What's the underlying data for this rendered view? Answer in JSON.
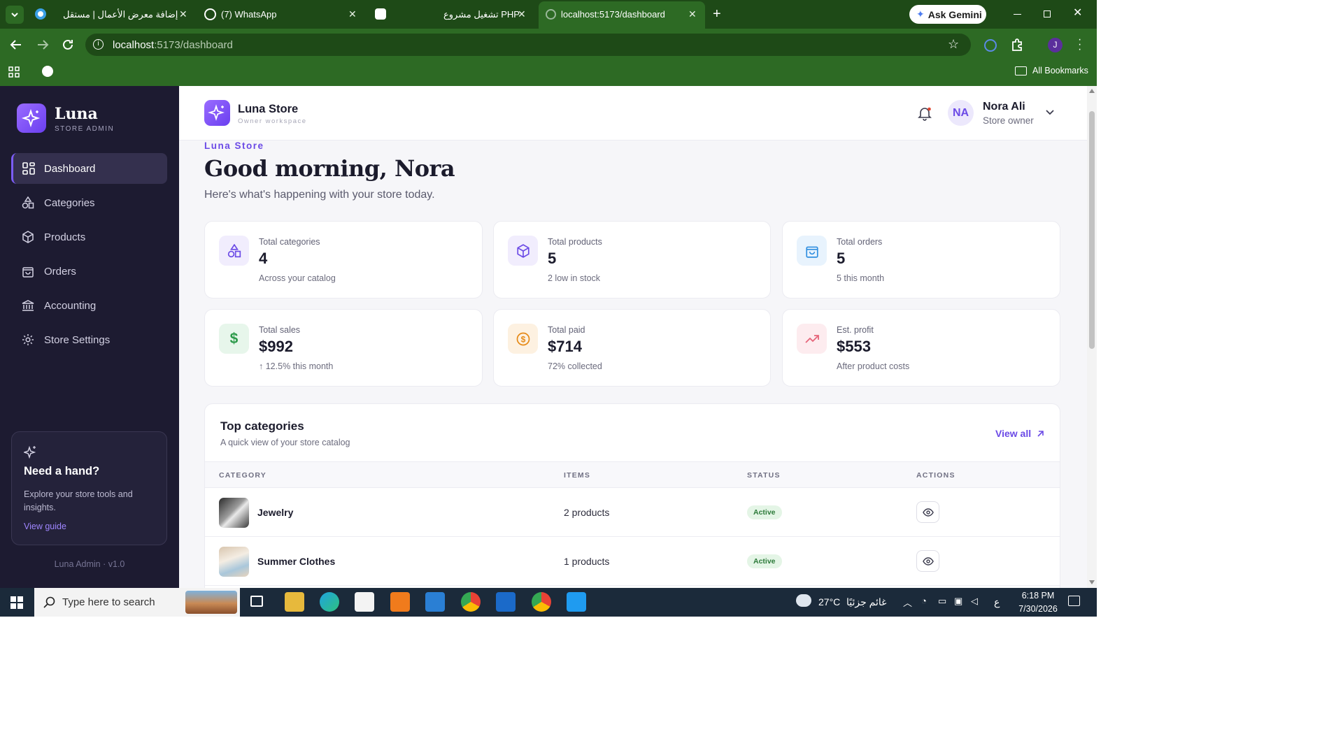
{
  "browser": {
    "tabs": [
      {
        "title": "إضافة معرض الأعمال | مستقل",
        "close": "✕"
      },
      {
        "title": "(7) WhatsApp",
        "close": "✕"
      },
      {
        "title": "تشغيل مشروع PHP",
        "close": "✕"
      },
      {
        "title": "localhost:5173/dashboard",
        "close": "✕"
      }
    ],
    "new_tab": "+",
    "ask_gemini": "Ask Gemini",
    "url_host": "localhost",
    "url_rest": ":5173/dashboard",
    "profile_initial": "J",
    "all_bookmarks": "All Bookmarks"
  },
  "sidebar": {
    "brand": "Luna",
    "brand_sub": "STORE ADMIN",
    "items": [
      {
        "label": "Dashboard",
        "icon": "grid-icon"
      },
      {
        "label": "Categories",
        "icon": "shapes-icon"
      },
      {
        "label": "Products",
        "icon": "box-icon"
      },
      {
        "label": "Orders",
        "icon": "bag-icon"
      },
      {
        "label": "Accounting",
        "icon": "bank-icon"
      },
      {
        "label": "Store Settings",
        "icon": "gear-icon"
      }
    ],
    "help": {
      "title": "Need a hand?",
      "text": "Explore your store tools and insights.",
      "link": "View guide"
    },
    "version": "Luna Admin · v1.0"
  },
  "header": {
    "store": "Luna Store",
    "store_sub": "Owner workspace",
    "avatar": "NA",
    "user": "Nora Ali",
    "role": "Store owner"
  },
  "hero": {
    "eyebrow": "Luna Store",
    "greeting": "Good morning, Nora",
    "sub": "Here's what's happening with your store today."
  },
  "stats": [
    {
      "label": "Total categories",
      "value": "4",
      "sub": "Across your catalog",
      "icon": "shapes-icon"
    },
    {
      "label": "Total products",
      "value": "5",
      "sub": "2 low in stock",
      "icon": "box-icon"
    },
    {
      "label": "Total orders",
      "value": "5",
      "sub": "5 this month",
      "icon": "bag-icon"
    },
    {
      "label": "Total sales",
      "value": "$992",
      "sub": "12.5% this month",
      "icon": "dollar-icon"
    },
    {
      "label": "Total paid",
      "value": "$714",
      "sub": "72% collected",
      "icon": "coin-icon"
    },
    {
      "label": "Est. profit",
      "value": "$553",
      "sub": "After product costs",
      "icon": "trend-up-icon"
    }
  ],
  "colors": {
    "accent": "#7b5cf5",
    "sidebar": "#1d1b31",
    "active_badge": "#2c7a39"
  },
  "top_categories": {
    "title": "Top categories",
    "sub": "A quick view of your store catalog",
    "view_all": "View all",
    "columns": [
      "CATEGORY",
      "ITEMS",
      "STATUS",
      "ACTIONS"
    ],
    "rows": [
      {
        "name": "Jewelry",
        "items": "2 products",
        "status": "Active"
      },
      {
        "name": "Summer Clothes",
        "items": "1 products",
        "status": "Active"
      }
    ]
  },
  "taskbar": {
    "search": "Type here to search",
    "weather": "27°C",
    "weather_text": "غائم جزئيًا",
    "lang": "ع",
    "time": "6:18 PM",
    "date": "7/30/2026"
  }
}
